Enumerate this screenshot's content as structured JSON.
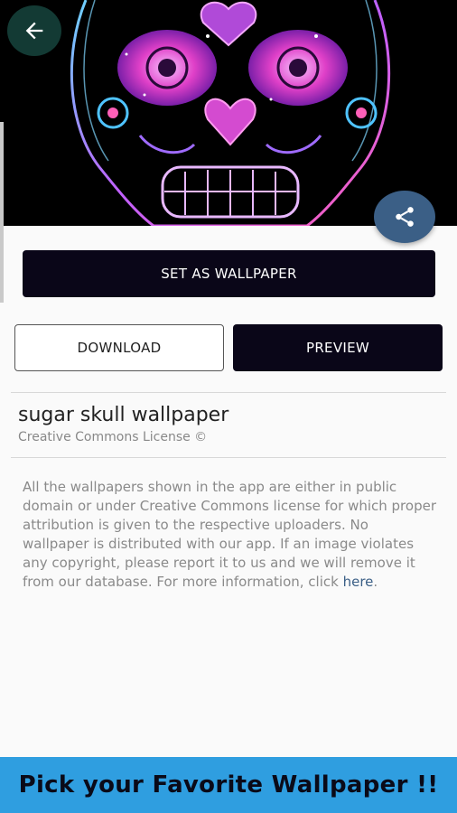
{
  "hero": {
    "image_name": "sugar-skull-wallpaper-image"
  },
  "nav": {
    "back_icon": "arrow-left-icon",
    "share_icon": "share-icon"
  },
  "actions": {
    "set_wallpaper": "SET AS WALLPAPER",
    "download": "DOWNLOAD",
    "preview": "PREVIEW"
  },
  "info": {
    "title": "sugar skull wallpaper",
    "license": "Creative Commons License ©"
  },
  "disclaimer": {
    "text": "All the wallpapers shown in the app are either in public domain or under Creative Commons license for which proper attribution is given to the respective uploaders. No wallpaper is distributed with our app. If an image violates any copyright, please report it to us and we will remove it from our database. For more information, click ",
    "link_text": "here",
    "end": "."
  },
  "banner": {
    "text": "Pick your Favorite Wallpaper !!"
  },
  "colors": {
    "accent": "#2f9ee0",
    "button_dark": "#0a0618",
    "share_fab": "#3b5f86"
  }
}
